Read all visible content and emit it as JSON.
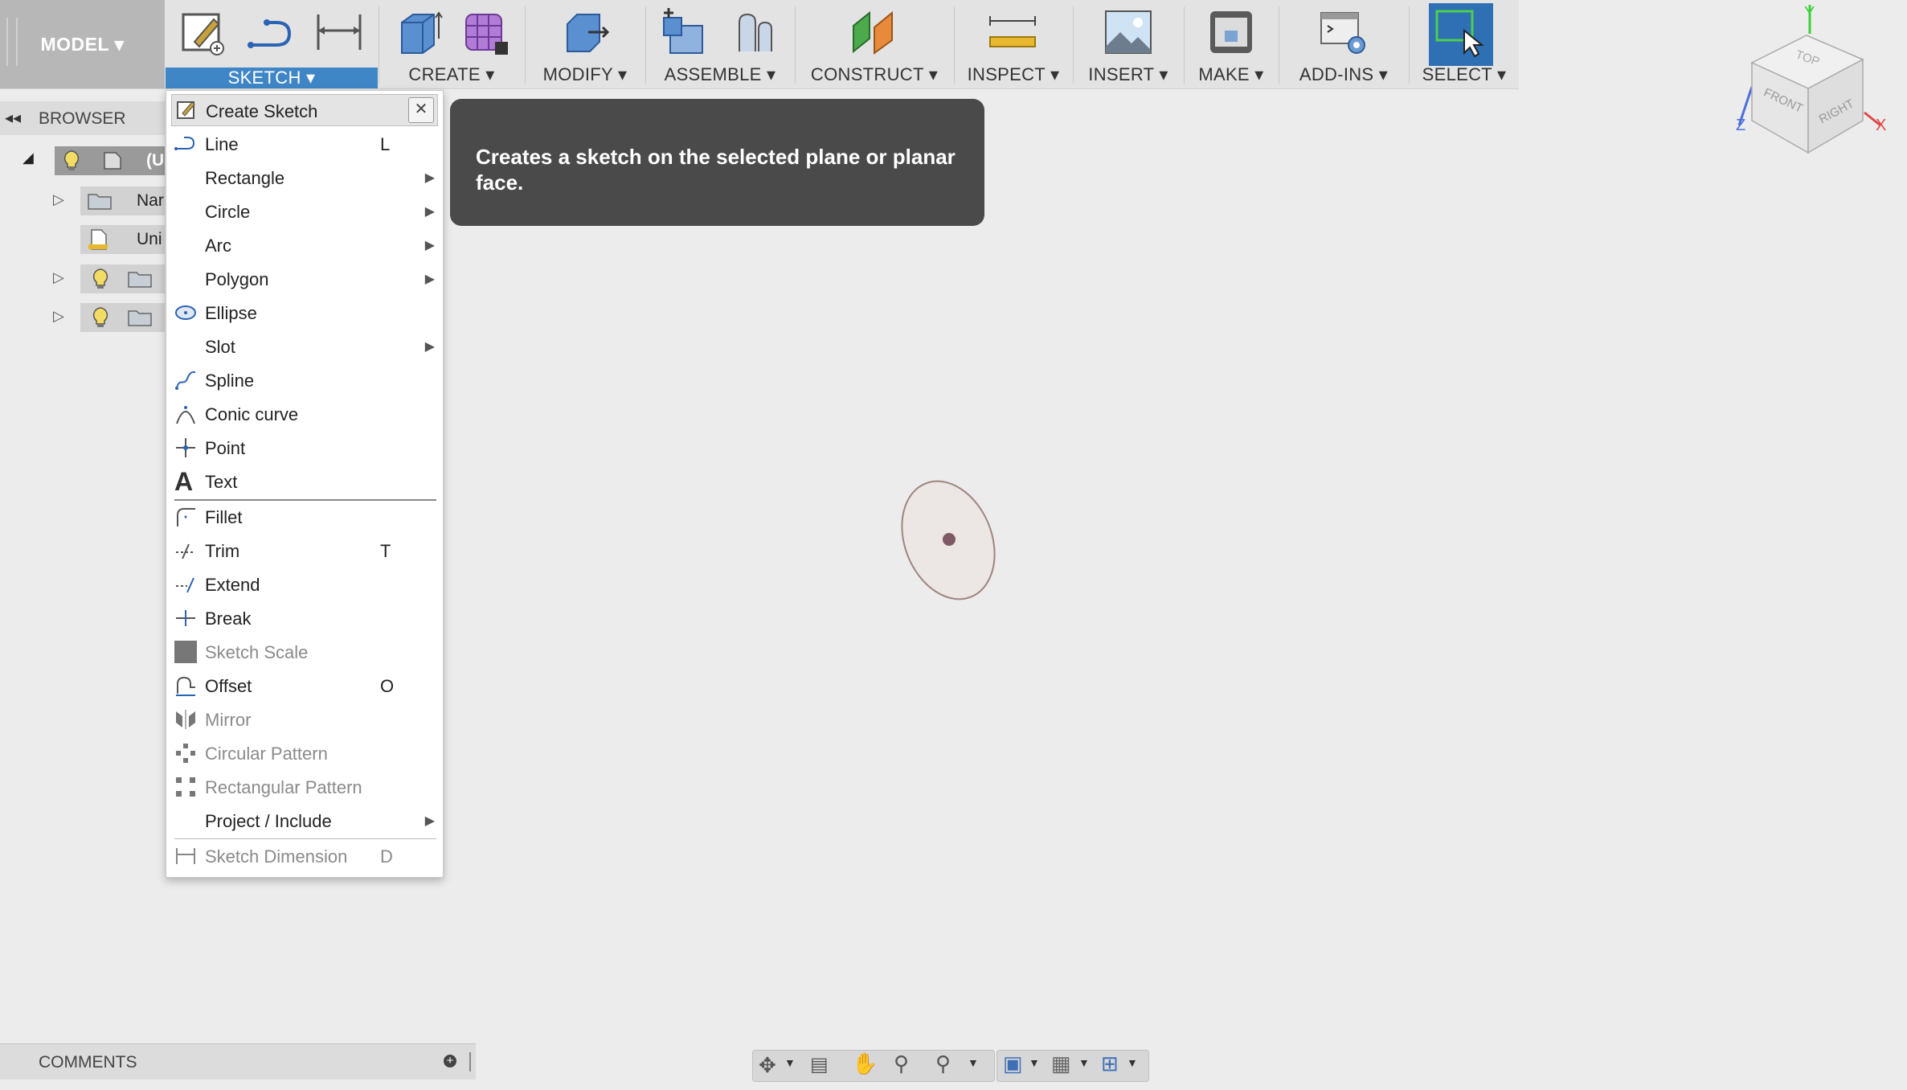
{
  "toolbar": {
    "model_label": "MODEL ▾",
    "groups": [
      {
        "label": "SKETCH ▾"
      },
      {
        "label": "CREATE ▾"
      },
      {
        "label": "MODIFY ▾"
      },
      {
        "label": "ASSEMBLE ▾"
      },
      {
        "label": "CONSTRUCT ▾"
      },
      {
        "label": "INSPECT ▾"
      },
      {
        "label": "INSERT ▾"
      },
      {
        "label": "MAKE ▾"
      },
      {
        "label": "ADD-INS ▾"
      },
      {
        "label": "SELECT ▾"
      }
    ]
  },
  "browser": {
    "title": "BROWSER",
    "rows": [
      {
        "label": "(U"
      },
      {
        "label": "Nar"
      },
      {
        "label": "Uni"
      }
    ]
  },
  "menu": {
    "header": "Create Sketch",
    "items": [
      {
        "label": "Line",
        "shortcut": "L"
      },
      {
        "label": "Rectangle"
      },
      {
        "label": "Circle"
      },
      {
        "label": "Arc"
      },
      {
        "label": "Polygon"
      },
      {
        "label": "Ellipse"
      },
      {
        "label": "Slot"
      },
      {
        "label": "Spline"
      },
      {
        "label": "Conic curve"
      },
      {
        "label": "Point"
      },
      {
        "label": "Text"
      },
      {
        "label": "Fillet"
      },
      {
        "label": "Trim",
        "shortcut": "T"
      },
      {
        "label": "Extend"
      },
      {
        "label": "Break"
      },
      {
        "label": "Sketch Scale"
      },
      {
        "label": "Offset",
        "shortcut": "O"
      },
      {
        "label": "Mirror"
      },
      {
        "label": "Circular Pattern"
      },
      {
        "label": "Rectangular Pattern"
      },
      {
        "label": "Project / Include"
      },
      {
        "label": "Sketch Dimension",
        "shortcut": "D"
      }
    ]
  },
  "tooltip": {
    "text": "Creates a sketch on the selected plane or planar face."
  },
  "viewcube": {
    "top": "TOP",
    "front": "FRONT",
    "right": "RIGHT",
    "x": "X",
    "y": "Y",
    "z": "Z"
  },
  "comments": {
    "label": "COMMENTS"
  },
  "colors": {
    "accent": "#3e86c6",
    "menu_bg": "#ffffff",
    "tooltip_bg": "#4a4a4a"
  }
}
